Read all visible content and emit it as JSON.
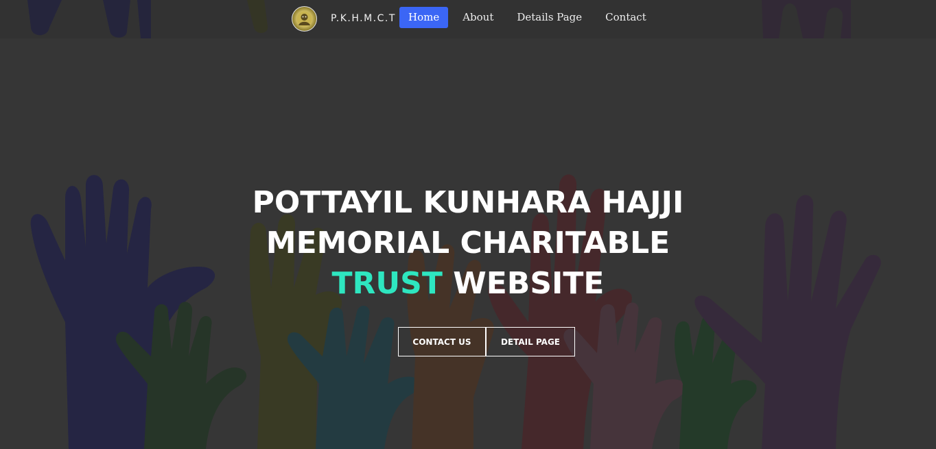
{
  "brand": {
    "name": "P.K.H.M.C.T"
  },
  "nav": {
    "items": [
      {
        "label": "Home",
        "active": true
      },
      {
        "label": "About",
        "active": false
      },
      {
        "label": "Details Page",
        "active": false
      },
      {
        "label": "Contact",
        "active": false
      }
    ]
  },
  "hero": {
    "line1": "POTTAYIL KUNHARA HAJJI",
    "line2": "MEMORIAL CHARITABLE",
    "line3_accent": "TRUST",
    "line3_rest": "WEBSITE",
    "contact_button": "CONTACT US",
    "detail_button": "DETAIL PAGE"
  },
  "colors": {
    "accent": "#2ee6c0",
    "active_nav": "#3b66f5",
    "overlay": "#363636"
  }
}
